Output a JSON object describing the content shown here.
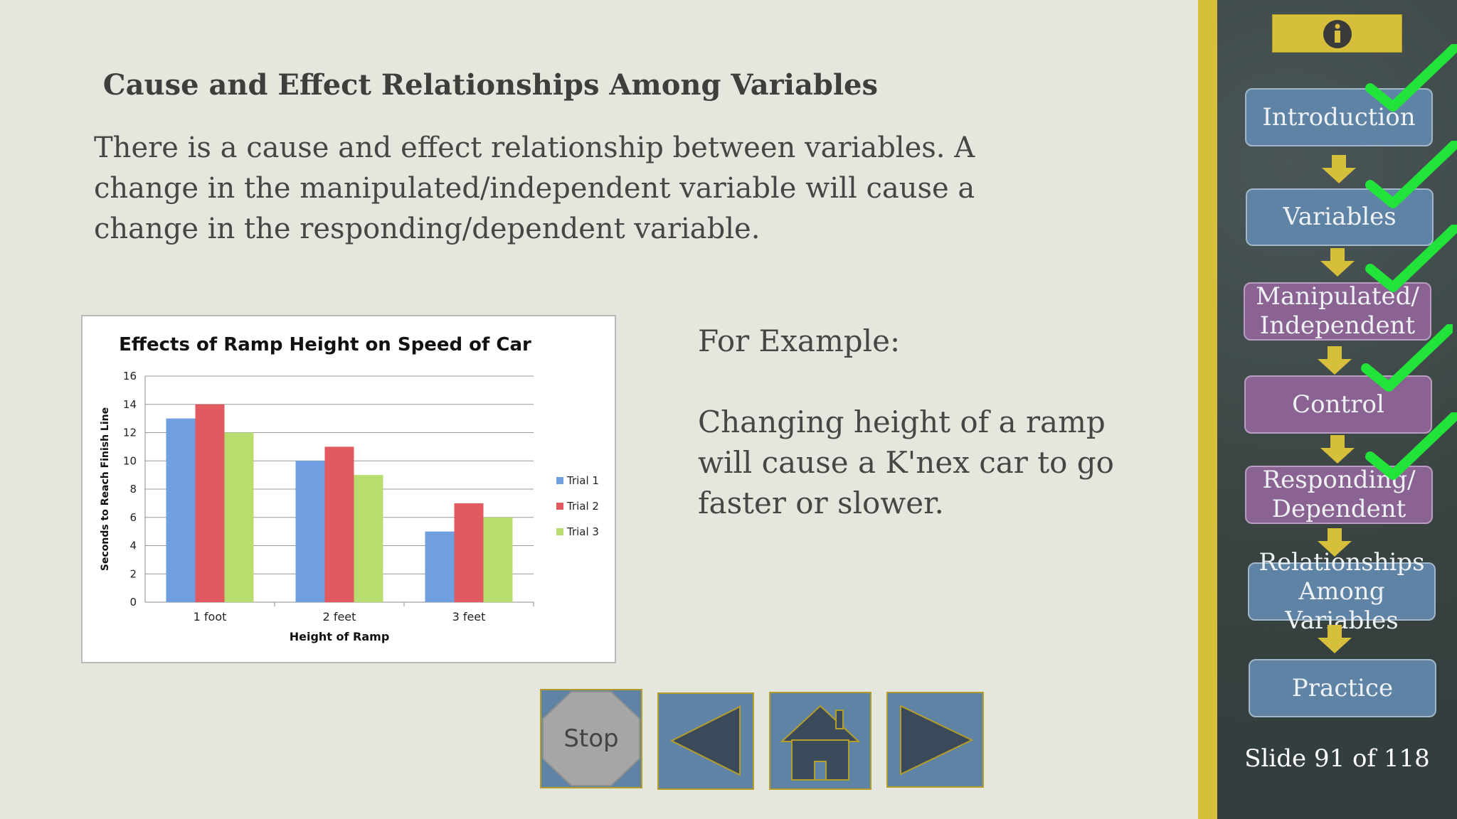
{
  "slide": {
    "title": "Cause and Effect Relationships Among Variables",
    "intro": "There is a cause and effect relationship between variables. A change in the manipulated/independent variable will cause a change in the responding/dependent variable.",
    "example_label": "For Example:",
    "example_text": "Changing height of a ramp will cause a K'nex car to go faster or slower."
  },
  "chart_data": {
    "type": "bar",
    "title": "Effects of Ramp Height on Speed of Car",
    "xlabel": "Height of Ramp",
    "ylabel": "Seconds to Reach Finish Line",
    "categories": [
      "1 foot",
      "2 feet",
      "3 feet"
    ],
    "series": [
      {
        "name": "Trial 1",
        "values": [
          13,
          10,
          5
        ],
        "color": "#6f9fe0"
      },
      {
        "name": "Trial 2",
        "values": [
          14,
          11,
          7
        ],
        "color": "#e05a5f"
      },
      {
        "name": "Trial 3",
        "values": [
          12,
          9,
          6
        ],
        "color": "#b6dd6e"
      }
    ],
    "ylim": [
      0,
      16
    ],
    "yticks": [
      "0",
      "2",
      "4",
      "6",
      "8",
      "10",
      "12",
      "14",
      "16"
    ],
    "grid": true,
    "legend_position": "right"
  },
  "navigation": {
    "stop_label": "Stop",
    "back_icon": "left-triangle",
    "home_icon": "house",
    "forward_icon": "right-triangle"
  },
  "sidebar": {
    "info_icon": "info-icon",
    "items": [
      {
        "lines": [
          "Introduction"
        ],
        "completed": true
      },
      {
        "lines": [
          "Variables"
        ],
        "completed": true
      },
      {
        "lines": [
          "Manipulated/",
          "Independent"
        ],
        "completed": true
      },
      {
        "lines": [
          "Control"
        ],
        "completed": true
      },
      {
        "lines": [
          "Responding/",
          "Dependent"
        ],
        "completed": true
      },
      {
        "lines": [
          "Relationships",
          "Among Variables"
        ],
        "completed": false
      },
      {
        "lines": [
          "Practice"
        ],
        "completed": false
      }
    ],
    "slide_counter": "Slide 91 of 118"
  },
  "colors": {
    "accent_gold": "#d6bf3a",
    "button_blue": "#5e83a5",
    "button_purple": "#8a6393",
    "checkmark_green": "#22e33a",
    "sidebar_bg": "#3c4649"
  }
}
